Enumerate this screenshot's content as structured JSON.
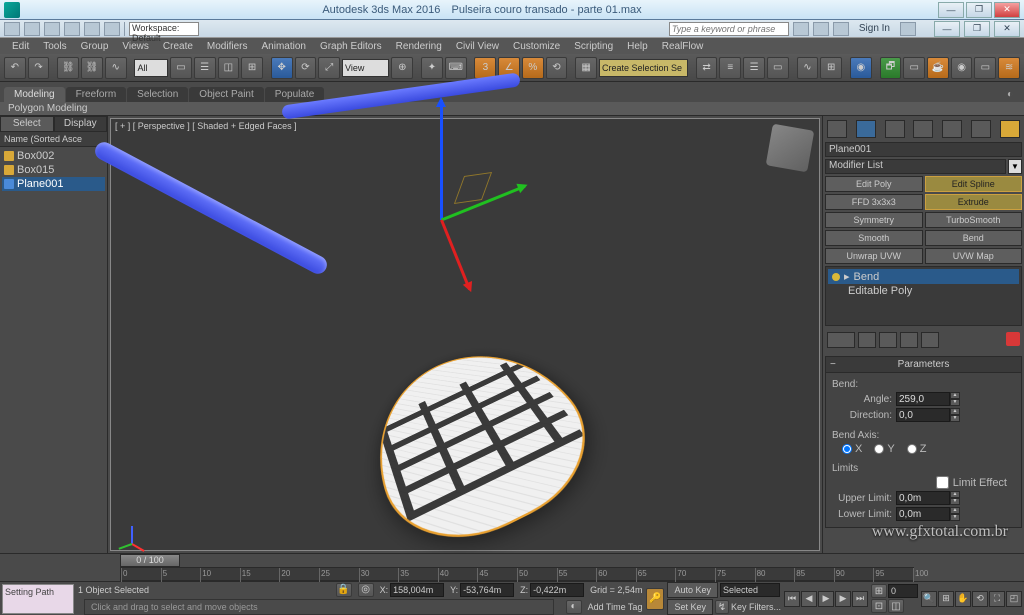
{
  "app": {
    "title": "Autodesk 3ds Max 2016",
    "filename": "Pulseira couro transado - parte 01.max",
    "workspace_label": "Workspace: Default",
    "search_placeholder": "Type a keyword or phrase",
    "signin": "Sign In"
  },
  "menu": [
    "Edit",
    "Tools",
    "Group",
    "Views",
    "Create",
    "Modifiers",
    "Animation",
    "Graph Editors",
    "Rendering",
    "Civil View",
    "Customize",
    "Scripting",
    "Help",
    "RealFlow"
  ],
  "toolbar": {
    "drop1": "All",
    "drop2": "View",
    "drop3": "Create Selection Se"
  },
  "ribbon": {
    "tabs": [
      "Modeling",
      "Freeform",
      "Selection",
      "Object Paint",
      "Populate"
    ],
    "active": 0,
    "sub": "Polygon Modeling"
  },
  "left": {
    "tabs": [
      "Select",
      "Display"
    ],
    "header": "Name (Sorted Asce",
    "items": [
      {
        "name": "Box002",
        "sel": false
      },
      {
        "name": "Box015",
        "sel": false
      },
      {
        "name": "Plane001",
        "sel": true
      }
    ]
  },
  "viewport": {
    "label": "[ + ] [ Perspective ] [ Shaded + Edged Faces ]"
  },
  "right": {
    "object_name": "Plane001",
    "modifier_list": "Modifier List",
    "quick_buttons": [
      {
        "label": "Edit Poly",
        "active": false
      },
      {
        "label": "Edit Spline",
        "active": true
      },
      {
        "label": "FFD 3x3x3",
        "active": false
      },
      {
        "label": "Extrude",
        "active": true
      },
      {
        "label": "Symmetry",
        "active": false
      },
      {
        "label": "TurboSmooth",
        "active": false
      },
      {
        "label": "Smooth",
        "active": false
      },
      {
        "label": "Bend",
        "active": false
      },
      {
        "label": "Unwrap UVW",
        "active": false
      },
      {
        "label": "UVW Map",
        "active": false
      }
    ],
    "stack": [
      {
        "name": "Bend",
        "sel": true
      },
      {
        "name": "Editable Poly",
        "sel": false
      }
    ],
    "rollout": {
      "title": "Parameters",
      "bend_label": "Bend:",
      "angle_label": "Angle:",
      "angle_value": "259,0",
      "direction_label": "Direction:",
      "direction_value": "0,0",
      "axis_label": "Bend Axis:",
      "axes": [
        "X",
        "Y",
        "Z"
      ],
      "axis_selected": "X",
      "limits_label": "Limits",
      "limit_effect": "Limit Effect",
      "upper_label": "Upper Limit:",
      "upper_value": "0,0m",
      "lower_label": "Lower Limit:",
      "lower_value": "0,0m"
    }
  },
  "timeline": {
    "slider": "0 / 100",
    "ticks": [
      0,
      5,
      10,
      15,
      20,
      25,
      30,
      35,
      40,
      45,
      50,
      55,
      60,
      65,
      70,
      75,
      80,
      85,
      90,
      95,
      100
    ]
  },
  "status": {
    "left_box": "Setting Path",
    "selection": "1 Object Selected",
    "hint": "Click and drag to select and move objects",
    "x": "158,004m",
    "y": "-53,764m",
    "z": "-0,422m",
    "grid": "Grid = 2,54m",
    "add_time_tag": "Add Time Tag",
    "autokey": "Auto Key",
    "selected": "Selected",
    "setkey": "Set Key",
    "keyfilters": "Key Filters..."
  },
  "watermark": "www.gfxtotal.com.br"
}
